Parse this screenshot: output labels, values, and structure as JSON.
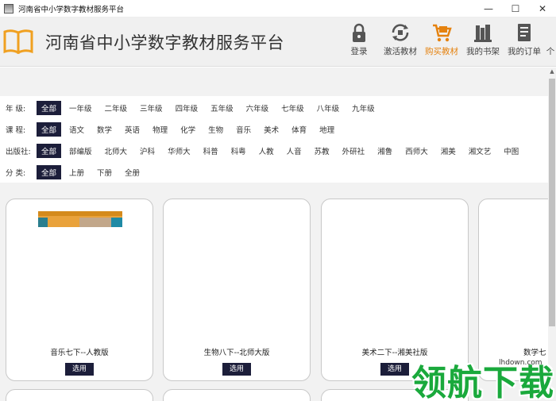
{
  "window": {
    "title": "河南省中小学数字教材服务平台",
    "controls": [
      "—",
      "☐",
      "✕"
    ]
  },
  "header": {
    "brand": "河南省中小学数字教材服务平台",
    "nav": [
      {
        "label": "登录",
        "icon": "lock-icon"
      },
      {
        "label": "激活教材",
        "icon": "activate-icon"
      },
      {
        "label": "购买教材",
        "icon": "cart-icon"
      },
      {
        "label": "我的书架",
        "icon": "bookshelf-icon"
      },
      {
        "label": "我的订单",
        "icon": "orders-icon"
      },
      {
        "label": "个",
        "icon": "user-icon"
      }
    ],
    "active_color": "#e5820f"
  },
  "filters": [
    {
      "label": "年  级:",
      "options": [
        "全部",
        "一年级",
        "二年级",
        "三年级",
        "四年级",
        "五年级",
        "六年级",
        "七年级",
        "八年级",
        "九年级"
      ],
      "selected": "全部"
    },
    {
      "label": "课  程:",
      "options": [
        "全部",
        "语文",
        "数学",
        "英语",
        "物理",
        "化学",
        "生物",
        "音乐",
        "美术",
        "体育",
        "地理"
      ],
      "selected": "全部"
    },
    {
      "label": "出版社:",
      "options": [
        "全部",
        "部编版",
        "北师大",
        "沪科",
        "华师大",
        "科普",
        "科粤",
        "人教",
        "人音",
        "苏教",
        "外研社",
        "湘鲁",
        "西师大",
        "湘美",
        "湘文艺",
        "中图"
      ],
      "selected": "全部"
    },
    {
      "label": "分  类:",
      "options": [
        "全部",
        "上册",
        "下册",
        "全册"
      ],
      "selected": "全部"
    }
  ],
  "books": [
    {
      "name": "音乐七下--人教版",
      "button": "选用"
    },
    {
      "name": "生物八下--北师大版",
      "button": "选用"
    },
    {
      "name": "美术二下--湘美社版",
      "button": "选用"
    },
    {
      "name": "数学七",
      "button": ""
    }
  ],
  "watermark": {
    "text": "领航下载",
    "site": "lhdown.com"
  },
  "colors": {
    "selected_bg": "#1c1e3a",
    "accent": "#e5820f",
    "watermark": "#1aa93c"
  }
}
